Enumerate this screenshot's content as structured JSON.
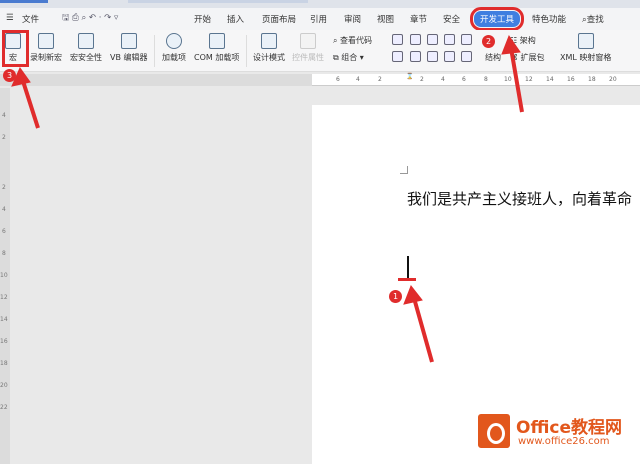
{
  "menu": {
    "file": "文件",
    "tabs": [
      "开始",
      "插入",
      "页面布局",
      "引用",
      "审阅",
      "视图",
      "章节",
      "安全",
      "开发工具",
      "特色功能"
    ],
    "search": "查找"
  },
  "ribbon": {
    "macro": "宏",
    "record": "录制新宏",
    "security": "宏安全性",
    "vb": "VB 编辑器",
    "addins": "加载项",
    "com": "COM 加载项",
    "design": "设计模式",
    "props": "控件属性",
    "viewcode": "查看代码",
    "group": "组合",
    "structure": "结构",
    "schema": "架构",
    "expansion": "扩展包",
    "xml": "XML 映射窗格"
  },
  "ruler": {
    "left_ticks": [
      "6",
      "4",
      "2"
    ],
    "right_ticks": [
      "2",
      "4",
      "6",
      "8",
      "10",
      "12",
      "14",
      "16",
      "18",
      "20"
    ],
    "v_ticks": [
      "4",
      "2",
      "2",
      "4",
      "6",
      "8",
      "10",
      "12",
      "14",
      "16",
      "18",
      "20",
      "22"
    ]
  },
  "document": {
    "text": "我们是共产主义接班人，向着革命"
  },
  "annotations": {
    "step1": "1",
    "step2": "2",
    "step3": "3",
    "color": "#e02c2c"
  },
  "watermark": {
    "name": "Office教程网",
    "url": "www.office26.com"
  }
}
